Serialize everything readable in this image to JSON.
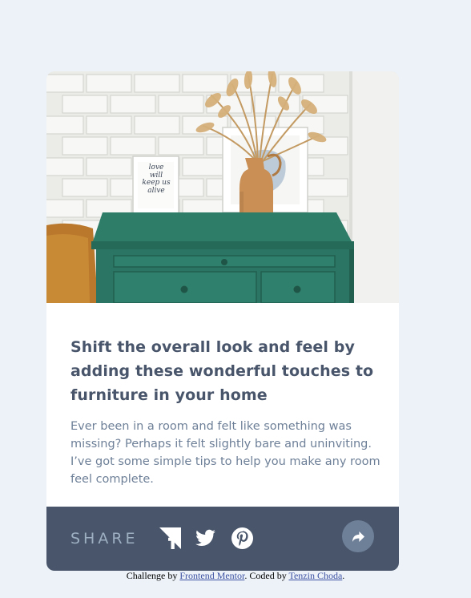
{
  "article": {
    "title": "Shift the overall look and feel by adding these wonderful touches to furniture in your home",
    "description": "Ever been in a room and felt like something was missing? Perhaps it felt slightly bare and uninviting. I’ve got some simple tips to help you make any room feel complete.",
    "frame_text": [
      "love",
      "will",
      "keep us",
      "alive"
    ]
  },
  "share": {
    "label": "SHARE",
    "icons": [
      "facebook-icon",
      "twitter-icon",
      "pinterest-icon",
      "share-icon"
    ]
  },
  "attribution": {
    "prefix": "Challenge by ",
    "link1": "Frontend Mentor",
    "middle": ". Coded by ",
    "link2": "Tenzin Choda",
    "suffix": "."
  },
  "colors": {
    "background": "#ecf2f8",
    "title": "#48556a",
    "text": "#6e8098",
    "footer": "#48556a",
    "share_label": "#9eafc2",
    "link": "#3e52a3"
  }
}
